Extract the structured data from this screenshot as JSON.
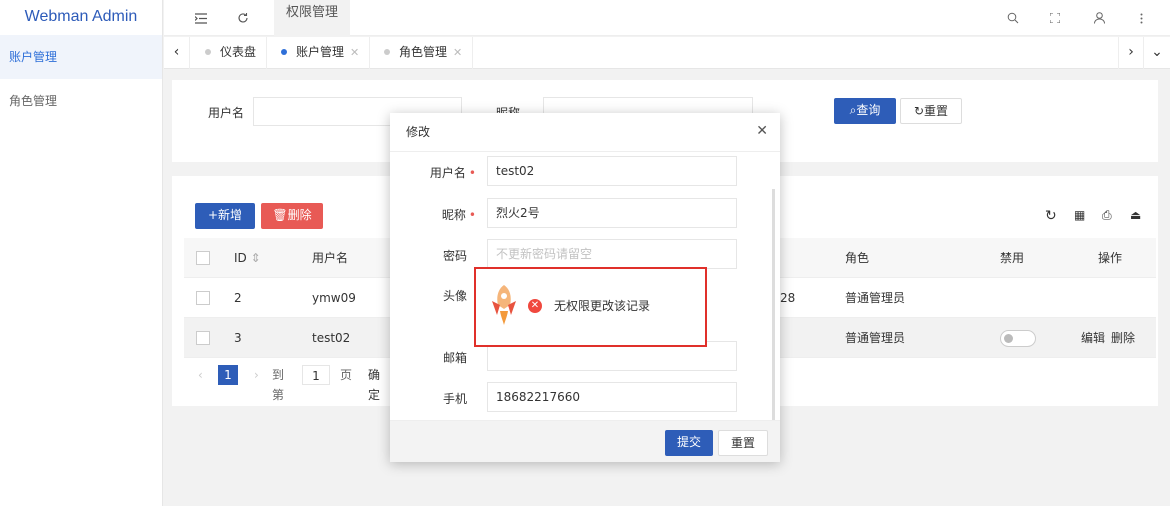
{
  "sidebar": {
    "logo": "Webman Admin",
    "items": [
      {
        "label": "账户管理"
      },
      {
        "label": "角色管理"
      }
    ]
  },
  "header": {
    "tab": "权限管理"
  },
  "tabs": [
    {
      "label": "仪表盘"
    },
    {
      "label": "账户管理"
    },
    {
      "label": "角色管理"
    }
  ],
  "search": {
    "username_label": "用户名",
    "nickname_label": "昵称",
    "query_label": "查询",
    "reset_label": "重置"
  },
  "toolbar": {
    "add_label": "+新增",
    "delete_label": "删除"
  },
  "table": {
    "columns": {
      "id": "ID",
      "username": "用户名",
      "role": "角色",
      "disabled": "禁用",
      "actions": "操作"
    },
    "rows": [
      {
        "id": "2",
        "username": "ymw09",
        "extra": "28",
        "role": "普通管理员"
      },
      {
        "id": "3",
        "username": "test02",
        "extra": "",
        "role": "普通管理员",
        "edit": "编辑",
        "delete": "删除"
      }
    ]
  },
  "pager": {
    "current": "1",
    "goto_label": "到第",
    "page_value": "1",
    "page_unit": "页",
    "confirm": "确定"
  },
  "modal": {
    "title": "修改",
    "fields": {
      "username_label": "用户名",
      "username_value": "test02",
      "nickname_label": "昵称",
      "nickname_value": "烈火2号",
      "password_label": "密码",
      "password_placeholder": "不更新密码请留空",
      "avatar_label": "头像",
      "email_label": "邮箱",
      "email_value": "",
      "phone_label": "手机",
      "phone_value": "18682217660"
    },
    "submit": "提交",
    "reset": "重置"
  },
  "toast": {
    "message": "无权限更改该记录"
  },
  "colors": {
    "primary": "#2e5db8",
    "danger": "#e85a55",
    "toast_border": "#e0302a"
  }
}
